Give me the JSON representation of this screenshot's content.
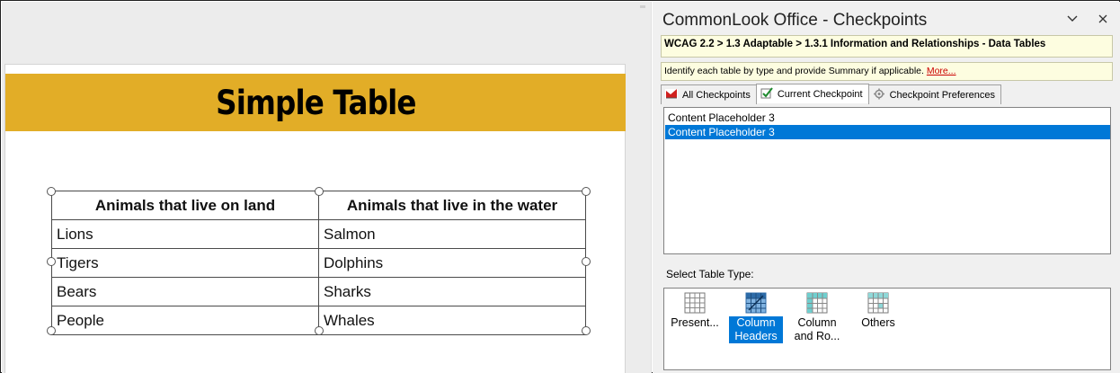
{
  "slide": {
    "title": "Simple Table",
    "table": {
      "headers": [
        "Animals that live on land",
        "Animals that live in the water"
      ],
      "rows": [
        [
          "Lions",
          "Salmon"
        ],
        [
          "Tigers",
          "Dolphins"
        ],
        [
          "Bears",
          "Sharks"
        ],
        [
          "People",
          "Whales"
        ]
      ]
    }
  },
  "pane": {
    "title": "CommonLook Office - Checkpoints",
    "collapse_icon": "chevron-down-icon",
    "close_icon": "close-icon",
    "breadcrumb": "WCAG 2.2 > 1.3 Adaptable > 1.3.1 Information and Relationships - Data Tables",
    "hint": "Identify each table by type and provide Summary if applicable.",
    "hint_more": "More...",
    "tabs": [
      {
        "label": "All Checkpoints",
        "icon": "checkpoints-icon"
      },
      {
        "label": "Current Checkpoint",
        "icon": "checkmark-icon",
        "active": true
      },
      {
        "label": "Checkpoint Preferences",
        "icon": "preferences-icon"
      }
    ],
    "list_items": [
      {
        "label": "Content Placeholder 3",
        "selected": false
      },
      {
        "label": "Content Placeholder 3",
        "selected": true
      }
    ],
    "select_type_label": "Select Table Type:",
    "table_types": [
      {
        "label": "Present...",
        "icon": "grid-table-icon",
        "selected": false
      },
      {
        "label": "Column Headers",
        "icon": "column-headers-icon",
        "selected": true
      },
      {
        "label": "Column and Ro...",
        "icon": "column-row-headers-icon",
        "selected": false
      },
      {
        "label": "Others",
        "icon": "others-table-icon",
        "selected": false
      }
    ]
  },
  "colors": {
    "title_band": "#e2ad27",
    "selection": "#0078d7",
    "hint_bg": "#fdfde0",
    "more_link": "#cc0000"
  }
}
